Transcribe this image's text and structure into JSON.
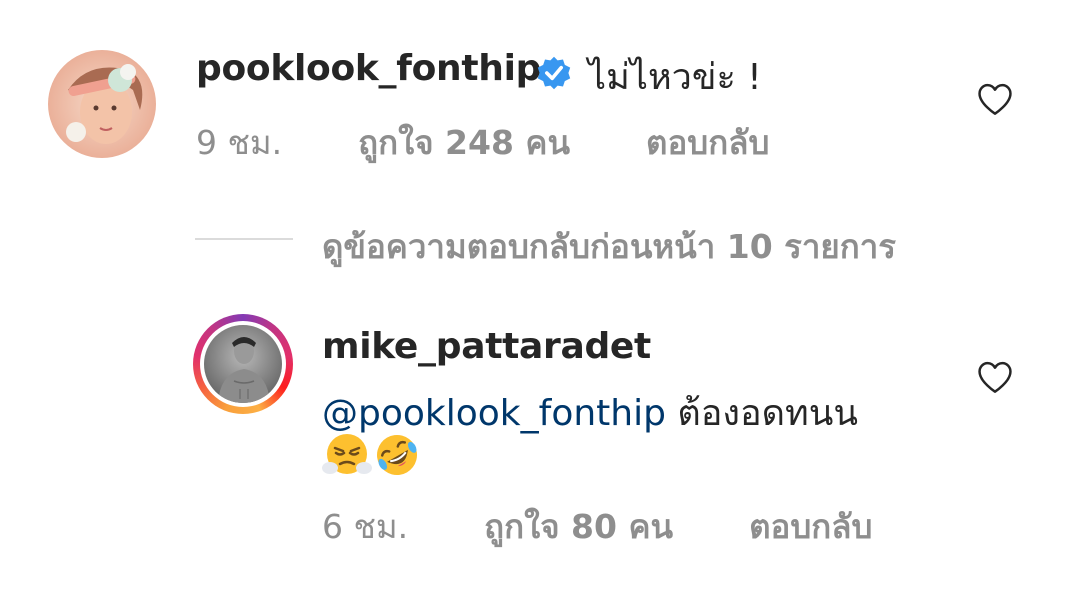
{
  "comments": [
    {
      "username": "pooklook_fonthip",
      "verified": true,
      "text": "ไม่ไหวข่ะ !",
      "time": "9 ชม.",
      "likes": "ถูกใจ 248 คน",
      "reply": "ตอบกลับ"
    },
    {
      "username": "mike_pattaradet",
      "verified": false,
      "mention": "@pooklook_fonthip",
      "text": "ต้องอดทนน",
      "emojis": [
        "face-with-steam-icon",
        "rolling-on-floor-laughing-icon"
      ],
      "time": "6 ชม.",
      "likes": "ถูกใจ 80 คน",
      "reply": "ตอบกลับ"
    }
  ],
  "view_replies": "ดูข้อความตอบกลับก่อนหน้า 10 รายการ",
  "colors": {
    "username": "#262626",
    "mention": "#00376b",
    "meta": "#8e8e8e",
    "verified": "#3897f0",
    "divider": "#dbdbdb"
  }
}
